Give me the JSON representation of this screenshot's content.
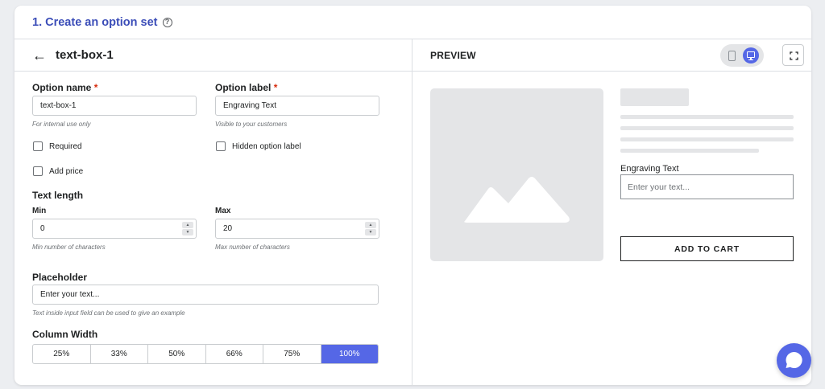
{
  "header": {
    "title": "1. Create an option set",
    "help_icon": "question-circle-icon",
    "help_glyph": "?"
  },
  "editor": {
    "back_icon": "arrow-left-icon",
    "back_glyph": "←",
    "name": "text-box-1",
    "option_name": {
      "label": "Option name",
      "required_mark": "*",
      "value": "text-box-1",
      "help": "For internal use only"
    },
    "option_label": {
      "label": "Option label",
      "required_mark": "*",
      "value": "Engraving Text",
      "help": "Visible to your customers"
    },
    "required_label": "Required",
    "hidden_label": "Hidden option label",
    "add_price_label": "Add price",
    "text_length": {
      "label": "Text length",
      "min_label": "Min",
      "min_value": "0",
      "min_help": "Min number of characters",
      "max_label": "Max",
      "max_value": "20",
      "max_help": "Max number of characters",
      "up_glyph": "▲",
      "down_glyph": "▼"
    },
    "placeholder": {
      "label": "Placeholder",
      "value": "Enter your text...",
      "help": "Text inside input field can be used to give an example"
    },
    "column_width": {
      "label": "Column Width",
      "options": [
        "25%",
        "33%",
        "50%",
        "66%",
        "75%",
        "100%"
      ],
      "selected": "100%"
    }
  },
  "preview": {
    "title": "PREVIEW",
    "device_icons": [
      "mobile-icon",
      "desktop-icon"
    ],
    "active_device": "desktop",
    "option_label": "Engraving Text",
    "input_placeholder": "Enter your text...",
    "cart_button": "ADD TO CART"
  },
  "colors": {
    "accent": "#5567e6",
    "title": "#3b4db8",
    "required": "#d72c0d"
  }
}
